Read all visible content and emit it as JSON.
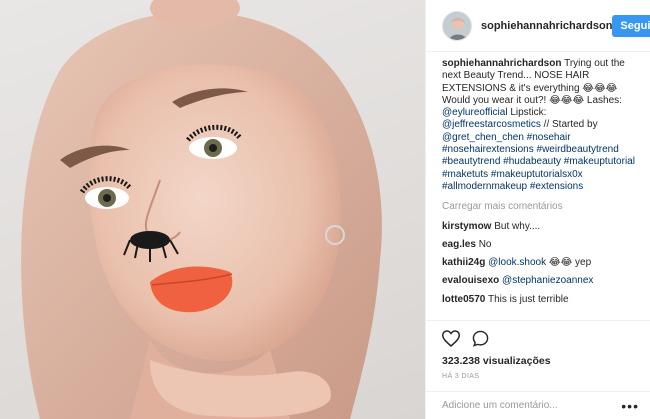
{
  "post": {
    "username": "sophiehannahrichardson",
    "follow_label": "Seguir"
  },
  "caption": {
    "username": "sophiehannahrichardson",
    "text1": "Trying out the next Beauty Trend... NOSE HAIR EXTENSIONS & it's everything 😂😂😂 Would you wear it out?! 😂😂😂 Lashes: ",
    "mention_lashes": "@eylureofficial",
    "text2": " Lipstick: ",
    "mention_lipstick": "@jeffreestarcosmetics",
    "text3": " // Started by ",
    "mention_started": "@gret_chen_chen",
    "hashtags": [
      "#nosehair",
      "#nosehairextensions",
      "#weirdbeautytrend",
      "#beautytrend",
      "#hudabeauty",
      "#makeuptutorial",
      "#maketuts",
      "#makeuptutorialsx0x",
      "#allmodernmakeup",
      "#extensions"
    ]
  },
  "load_more_label": "Carregar mais comentários",
  "comments": [
    {
      "user": "kirstymow",
      "text": "But why...."
    },
    {
      "user": "eag.les",
      "text": "No"
    },
    {
      "user": "kathii24g",
      "mention": "@look.shook",
      "text": " 😂😂 yep"
    },
    {
      "user": "evalouisexo",
      "mention": "@stephaniezoannex",
      "text": ""
    },
    {
      "user": "lotte0570",
      "text": "This is just terrible"
    }
  ],
  "stats": {
    "views": "323.238 visualizações",
    "time": "HÁ 3 DIAS"
  },
  "add_comment_placeholder": "Adicione um comentário...",
  "more_options": "•••",
  "icons": {
    "like": "heart-icon",
    "comment": "comment-bubble-icon",
    "more": "more-options-icon"
  },
  "colors": {
    "follow_button": "#3897f0",
    "link": "#003569",
    "muted": "#999999",
    "lips": "#f0623f"
  }
}
